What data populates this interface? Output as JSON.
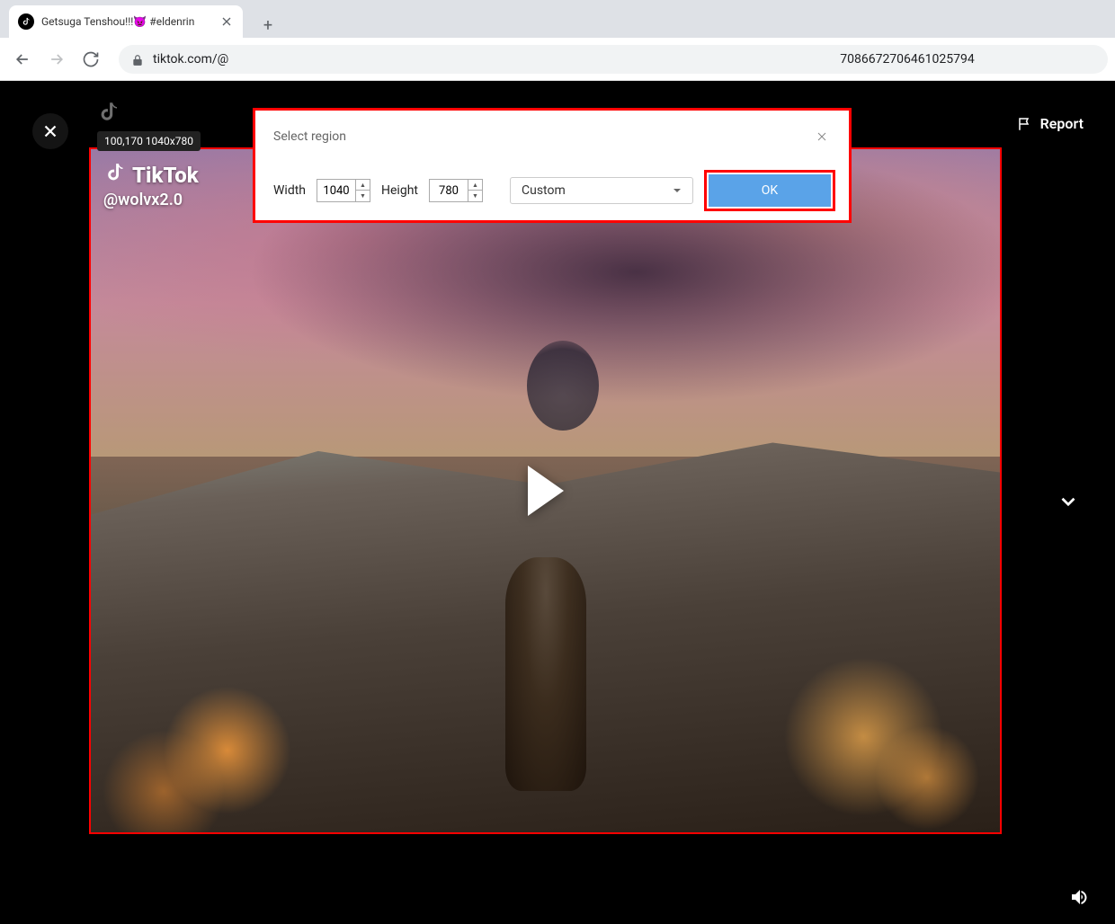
{
  "browser": {
    "tab_title": "Getsuga Tenshou!!!👿 #eldenrin",
    "url_prefix": "tiktok.com/@",
    "url_suffix": "7086672706461025794"
  },
  "region": {
    "tooltip": "100,170 1040x780"
  },
  "dialog": {
    "title": "Select region",
    "width_label": "Width",
    "width_value": "1040",
    "height_label": "Height",
    "height_value": "780",
    "dropdown_value": "Custom",
    "ok_label": "OK"
  },
  "video": {
    "brand": "TikTok",
    "username": "@wolvx2.0"
  },
  "actions": {
    "report_label": "Report"
  }
}
